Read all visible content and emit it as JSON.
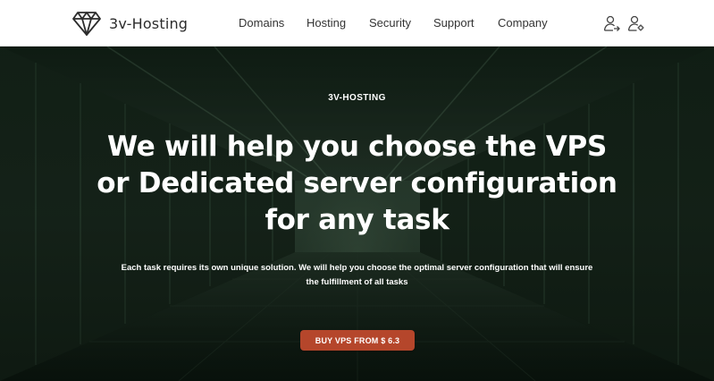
{
  "brand": {
    "name": "3v-Hosting",
    "logo_icon": "diamond-logo-icon"
  },
  "nav": {
    "items": [
      {
        "label": "Domains"
      },
      {
        "label": "Hosting"
      },
      {
        "label": "Security"
      },
      {
        "label": "Support"
      },
      {
        "label": "Company"
      }
    ]
  },
  "header_icons": {
    "login": "user-login-icon",
    "account": "user-settings-icon"
  },
  "hero": {
    "eyebrow": "3V-HOSTING",
    "headline": "We will help you choose the VPS or Dedicated server configuration for any task",
    "subtext": "Each task requires its own unique solution. We will help you choose the optimal server configuration that will ensure the fulfillment of all tasks",
    "cta_label": "BUY VPS FROM $ 6.3",
    "background": "server-room-corridor-photo"
  },
  "colors": {
    "cta": "#b5462b",
    "hero_tint": "#1c2b20",
    "nav_text": "#333333"
  }
}
